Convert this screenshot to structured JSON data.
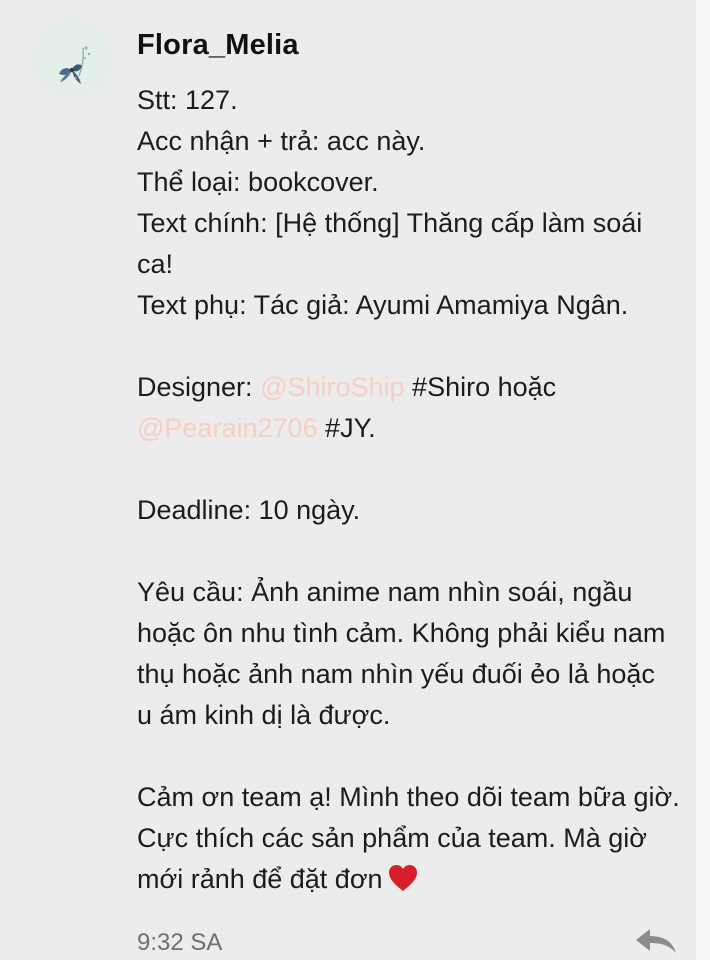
{
  "author": {
    "name": "Flora_Melia"
  },
  "message": {
    "stt": "Stt: 127.",
    "acc": "Acc nhận + trả: acc này.",
    "the_loai": "Thể loại: bookcover.",
    "text_chinh_1": "Text chính: [Hệ thống] Thăng cấp làm soái",
    "text_chinh_2": "ca!",
    "text_phu": "Text phụ: Tác giả: Ayumi Amamiya Ngân.",
    "designer_prefix": "Designer: ",
    "designer_mention_1": "@ShiroShip",
    "designer_mid": " #Shiro hoặc",
    "designer_mention_2": "@Pearain2706",
    "designer_suffix": " #JY.",
    "deadline": "Deadline: 10 ngày.",
    "yeu_cau_1": "Yêu cầu: Ảnh anime nam nhìn soái, ngầu",
    "yeu_cau_2": "hoặc ôn nhu tình cảm. Không phải kiểu nam",
    "yeu_cau_3": "thụ hoặc ảnh nam nhìn yếu đuối ẻo lả hoặc",
    "yeu_cau_4": "u ám kinh dị là được.",
    "cam_on_1": "Cảm ơn team ạ! Mình theo dõi team bữa giờ.",
    "cam_on_2": "Cực thích các sản phẩm của team. Mà giờ",
    "cam_on_3": "mới rảnh để đặt đơn"
  },
  "meta": {
    "time": "9:32 SA"
  },
  "icons": {
    "avatar": "flower-avatar-icon",
    "heart": "heart-icon",
    "reply": "reply-arrow-icon"
  },
  "colors": {
    "background": "#ececec",
    "mention": "#f6cfc4",
    "heart": "#d81e2c",
    "meta": "#6f6f6f"
  }
}
